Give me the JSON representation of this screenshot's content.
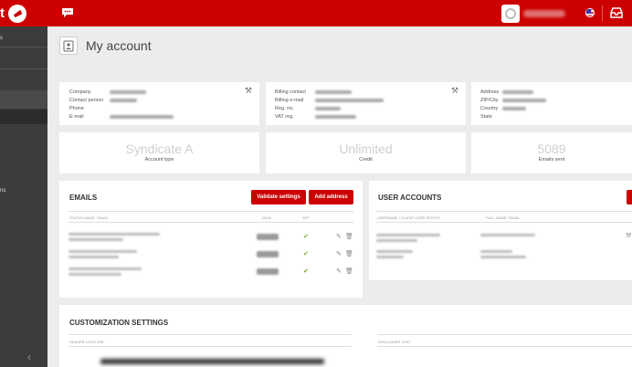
{
  "topbar": {
    "brand_text": "t",
    "colors": {
      "brand": "#cc0000",
      "sidebar": "#3c3c3c"
    }
  },
  "sidebar": {
    "items": [
      {
        "label": "s"
      },
      {
        "label": ""
      },
      {
        "label": ""
      },
      {
        "label": ""
      },
      {
        "label": "ns"
      }
    ]
  },
  "page": {
    "title": "My account"
  },
  "company_card": {
    "rows": [
      {
        "label": "Company"
      },
      {
        "label": "Contact person"
      },
      {
        "label": "Phone"
      },
      {
        "label": "E-mail"
      }
    ]
  },
  "billing_card": {
    "rows": [
      {
        "label": "Billing contact"
      },
      {
        "label": "Billing e-mail"
      },
      {
        "label": "Reg. no."
      },
      {
        "label": "VAT reg."
      }
    ]
  },
  "address_card": {
    "rows": [
      {
        "label": "Address"
      },
      {
        "label": "ZIP/City"
      },
      {
        "label": "Country"
      },
      {
        "label": "State"
      }
    ]
  },
  "stats": [
    {
      "value": "Syndicate A",
      "label": "Account type"
    },
    {
      "value": "Unlimited",
      "label": "Credit"
    },
    {
      "value": "5089",
      "label": "Emails sent"
    }
  ],
  "emails": {
    "title": "EMAILS",
    "validate_label": "Validate settings",
    "add_label": "Add address",
    "col_status": "STATUS",
    "col_name": "NAME / EMAIL",
    "col_dkim": "DKIM",
    "col_spf": "SPF",
    "rows": 3
  },
  "users": {
    "title": "USER ACCOUNTS",
    "col_user": "USERNAME / CLIENT USER RIGHTS",
    "col_fullname": "FULL NAME / EMAIL"
  },
  "customization": {
    "title": "CUSTOMIZATION SETTINGS",
    "header_logo_label": "HEADER LOGO URL",
    "disclaimer_label": "DISCLAIMER TEXT"
  }
}
